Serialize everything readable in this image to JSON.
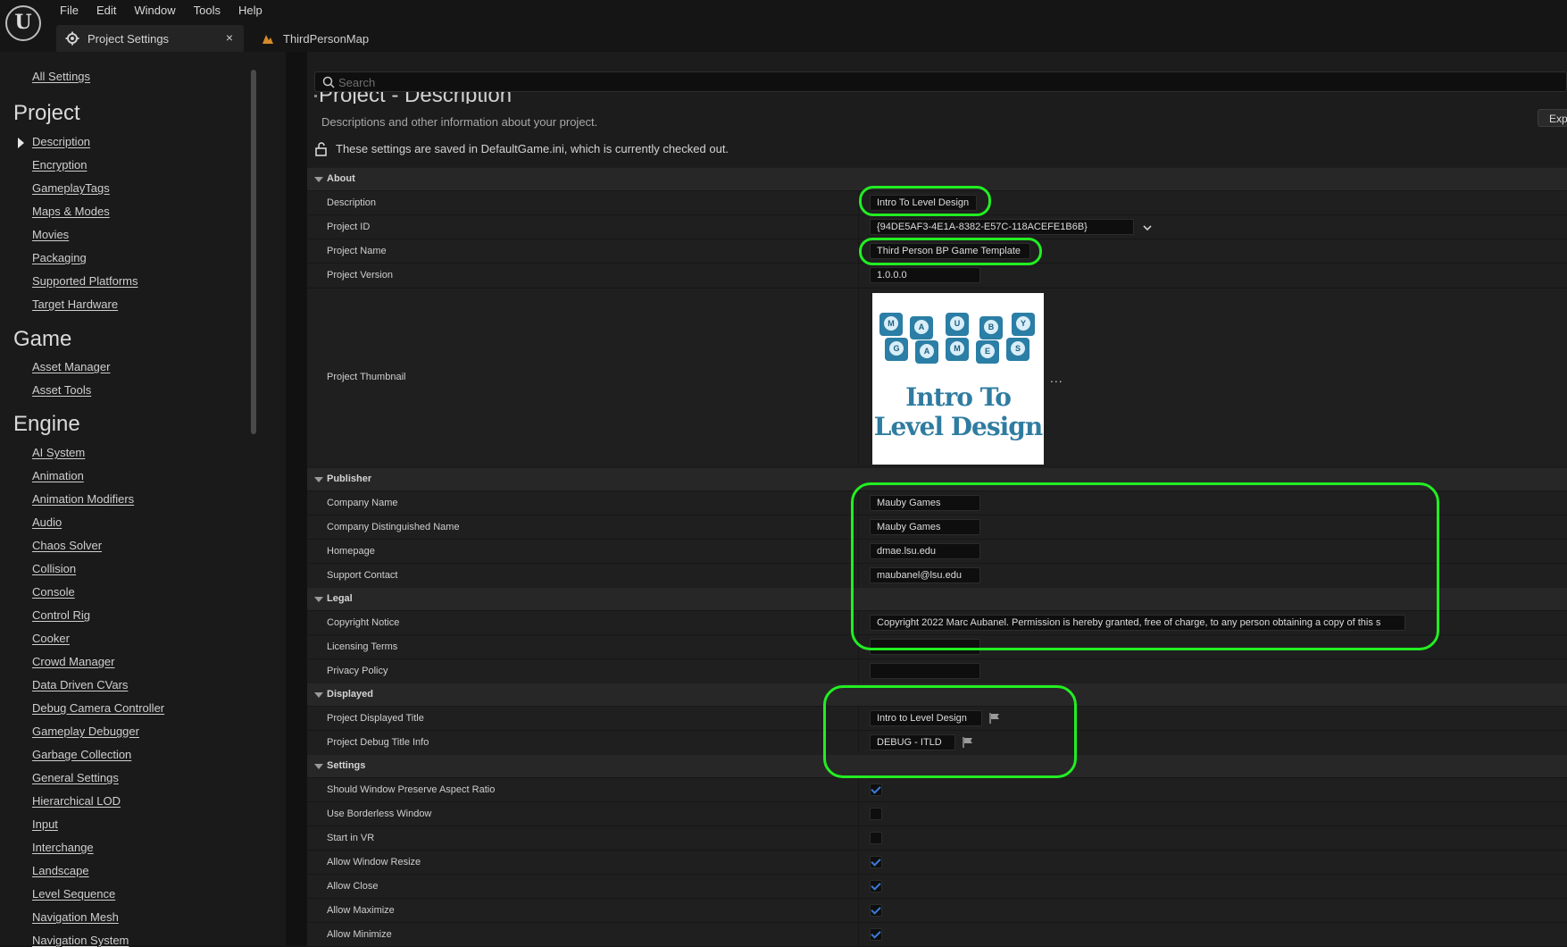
{
  "app": {
    "logo": "U",
    "menu": [
      "File",
      "Edit",
      "Window",
      "Tools",
      "Help"
    ],
    "tabs": [
      {
        "label": "Project Settings",
        "icon": "settings-icon",
        "close": "×"
      },
      {
        "label": "ThirdPersonMap",
        "icon": "level-icon"
      }
    ]
  },
  "sidebar": {
    "all_settings": "All Settings",
    "categories": {
      "project": {
        "title": "Project",
        "items": [
          "Description",
          "Encryption",
          "GameplayTags",
          "Maps & Modes",
          "Movies",
          "Packaging",
          "Supported Platforms",
          "Target Hardware"
        ]
      },
      "game": {
        "title": "Game",
        "items": [
          "Asset Manager",
          "Asset Tools"
        ]
      },
      "engine": {
        "title": "Engine",
        "items": [
          "AI System",
          "Animation",
          "Animation Modifiers",
          "Audio",
          "Chaos Solver",
          "Collision",
          "Console",
          "Control Rig",
          "Cooker",
          "Crowd Manager",
          "Data Driven CVars",
          "Debug Camera Controller",
          "Gameplay Debugger",
          "Garbage Collection",
          "General Settings",
          "Hierarchical LOD",
          "Input",
          "Interchange",
          "Landscape",
          "Level Sequence",
          "Navigation Mesh",
          "Navigation System"
        ]
      }
    }
  },
  "main": {
    "search_placeholder": "Search",
    "title": "Project - Description",
    "subtitle": "Descriptions and other information about your project.",
    "export_label": "Exp",
    "saved_note": "These settings are saved in DefaultGame.ini, which is currently checked out.",
    "sections": {
      "about": {
        "title": "About",
        "description": {
          "label": "Description",
          "value": "Intro To Level Design"
        },
        "project_id": {
          "label": "Project ID",
          "value": "{94DE5AF3-4E1A-8382-E57C-118ACEFE1B6B}"
        },
        "project_name": {
          "label": "Project Name",
          "value": "Third Person BP Game Template"
        },
        "project_version": {
          "label": "Project Version",
          "value": "1.0.0.0"
        },
        "project_thumbnail": {
          "label": "Project Thumbnail",
          "image_text": "Intro To Level Design",
          "dice_letters": [
            "M",
            "A",
            "U",
            "B",
            "Y",
            "G",
            "A",
            "M",
            "E",
            "S"
          ],
          "more": "..."
        }
      },
      "publisher": {
        "title": "Publisher",
        "company_name": {
          "label": "Company Name",
          "value": "Mauby Games"
        },
        "company_distinguished_name": {
          "label": "Company Distinguished Name",
          "value": "Mauby Games"
        },
        "homepage": {
          "label": "Homepage",
          "value": "dmae.lsu.edu"
        },
        "support_contact": {
          "label": "Support Contact",
          "value": "maubanel@lsu.edu"
        }
      },
      "legal": {
        "title": "Legal",
        "copyright_notice": {
          "label": "Copyright Notice",
          "value": "Copyright 2022 Marc Aubanel. Permission is hereby granted, free of charge, to any person obtaining a copy of this s"
        },
        "licensing_terms": {
          "label": "Licensing Terms",
          "value": ""
        },
        "privacy_policy": {
          "label": "Privacy Policy",
          "value": ""
        }
      },
      "displayed": {
        "title": "Displayed",
        "project_displayed_title": {
          "label": "Project Displayed Title",
          "value": "Intro to Level Design"
        },
        "project_debug_title_info": {
          "label": "Project Debug Title Info",
          "value": "DEBUG - ITLD"
        }
      },
      "settings": {
        "title": "Settings",
        "options": [
          {
            "label": "Should Window Preserve Aspect Ratio",
            "checked": true
          },
          {
            "label": "Use Borderless Window",
            "checked": false
          },
          {
            "label": "Start in VR",
            "checked": false
          },
          {
            "label": "Allow Window Resize",
            "checked": true
          },
          {
            "label": "Allow Close",
            "checked": true
          },
          {
            "label": "Allow Maximize",
            "checked": true
          },
          {
            "label": "Allow Minimize",
            "checked": true
          }
        ]
      }
    }
  },
  "colors": {
    "highlight": "#22ee22",
    "checkbox_check": "#3a7bd8",
    "thumbnail_text": "#2f7ca0"
  }
}
